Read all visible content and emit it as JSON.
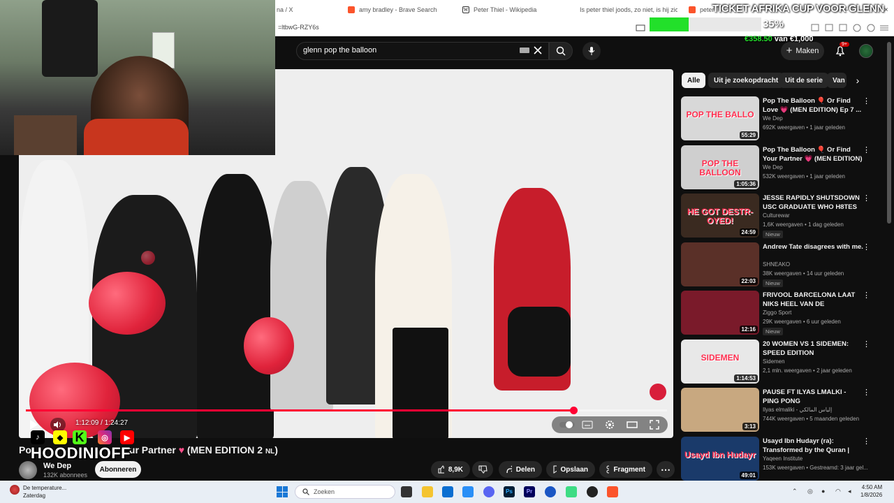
{
  "browser": {
    "tabs": [
      {
        "label": "na / X",
        "color": "#000000"
      },
      {
        "label": "amy bradley - Brave Search",
        "color": "#fb542b"
      },
      {
        "label": "Peter Thiel - Wikipedia",
        "color": "#333333"
      },
      {
        "label": "Is peter thiel joods, zo niet, is hij zion",
        "color": "#222222"
      },
      {
        "label": "peter",
        "color": "#fb542b"
      }
    ],
    "url": "=ltbwG-RZY6s",
    "window_controls": [
      "–",
      "□",
      "×"
    ]
  },
  "overlay": {
    "ticket_text": "TICKET AFRIKA CUP VOOR GLENN",
    "progress_percent": 35,
    "progress_label": "35%",
    "money_raised": "€358.50",
    "money_goal_text": "van €1,000",
    "handle": "HOODINIOFF",
    "socials": [
      "tiktok",
      "snapchat",
      "kick",
      "instagram",
      "youtube"
    ],
    "kick_letter": "K"
  },
  "youtube": {
    "search_query": "glenn pop the balloon",
    "make_label": "Maken",
    "notif_badge": "9+",
    "video": {
      "time": "1:12:09 / 1:24:27",
      "progress_fraction": 0.854,
      "title_visible_tail": "ur Partner",
      "title_prefix": "Po",
      "title_suffix": "(MEN EDITION 2",
      "title_lang": "NL",
      "channel": "We Dep",
      "subscribers": "132K abonnees",
      "subscribe_label": "Abonneren",
      "likes": "8,9K",
      "share_label": "Delen",
      "save_label": "Opslaan",
      "clip_label": "Fragment"
    },
    "chips": [
      "Alle",
      "Uit je zoekopdracht",
      "Uit de serie",
      "Van"
    ],
    "recommendations": [
      {
        "title": "Pop The Balloon 🎈 Or Find Love 💗 (MEN EDITION) Ep 7 ...",
        "channel": "We Dep",
        "meta": "692K weergaven • 1 jaar geleden",
        "duration": "55:29",
        "badge": "",
        "thumb_color": "#d8d8d8",
        "thumb_text": "POP THE BALLO"
      },
      {
        "title": "Pop The Balloon 🎈 Or Find Your Partner 💗 (MEN EDITION) NL",
        "channel": "We Dep",
        "meta": "532K weergaven • 1 jaar geleden",
        "duration": "1:05:36",
        "badge": "",
        "thumb_color": "#cfcfcf",
        "thumb_text": "POP THE BALLOON"
      },
      {
        "title": "JESSE RAPIDLY SHUTSDOWN USC GRADUATE WHO H8TES ...",
        "channel": "Culturewar",
        "meta": "1,6K weergaven • 1 dag geleden",
        "duration": "24:59",
        "badge": "Nieuw",
        "thumb_color": "#3a2a20",
        "thumb_text": "HE GOT DESTR-OYED!"
      },
      {
        "title": "Andrew Tate disagrees with me.",
        "channel": "SHNEAKO",
        "meta": "38K weergaven • 14 uur geleden",
        "duration": "22:03",
        "badge": "Nieuw",
        "thumb_color": "#5a3028",
        "thumb_text": ""
      },
      {
        "title": "FRIVOOL BARCELONA LAAT NIKS HEEL VAN DE BASKEN!!...",
        "channel": "Ziggo Sport",
        "meta": "29K weergaven • 6 uur geleden",
        "duration": "12:16",
        "badge": "Nieuw",
        "thumb_color": "#7a1a2a",
        "thumb_text": ""
      },
      {
        "title": "20 WOMEN VS 1 SIDEMEN: SPEED EDITION",
        "channel": "Sidemen",
        "meta": "2,1 mln. weergaven • 2 jaar geleden",
        "duration": "1:14:53",
        "badge": "",
        "thumb_color": "#e8e8e8",
        "thumb_text": "SIDEMEN"
      },
      {
        "title": "PAUSE FT ILYAS LMALKI - PING PONG",
        "channel": "Ilyas elmaliki - إلياس المالكي",
        "meta": "744K weergaven • 5 maanden geleden",
        "duration": "3:13",
        "badge": "",
        "thumb_color": "#c8a880",
        "thumb_text": ""
      },
      {
        "title": "Usayd Ibn Hudayr (ra): Transformed by the Quran | Th...",
        "channel": "Yaqeen Institute",
        "meta": "153K weergaven • Gestreamd: 3 jaar gel...",
        "duration": "49:01",
        "badge": "",
        "thumb_color": "#1a3a6a",
        "thumb_text": "Usayd Ibn Hudayr"
      }
    ]
  },
  "taskbar": {
    "weather_line1": "De temperature...",
    "weather_line2": "Zaterdag",
    "search_placeholder": "Zoeken",
    "time": "4:50 AM",
    "date": "1/8/2026"
  }
}
